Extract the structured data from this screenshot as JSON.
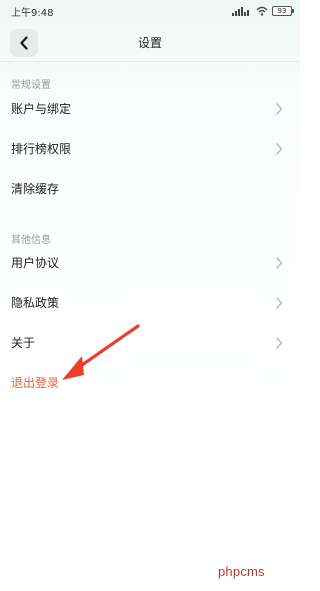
{
  "status_bar": {
    "time": "上午9:48",
    "battery": "93"
  },
  "nav": {
    "title": "设置"
  },
  "sections": {
    "general": {
      "header": "常规设置",
      "items": [
        {
          "label": "账户与绑定"
        },
        {
          "label": "排行榜权限"
        },
        {
          "label": "清除缓存"
        }
      ]
    },
    "other": {
      "header": "其他信息",
      "items": [
        {
          "label": "用户协议"
        },
        {
          "label": "隐私政策"
        },
        {
          "label": "关于"
        }
      ]
    }
  },
  "logout": {
    "label": "退出登录"
  },
  "annotation": {
    "arrow_color": "#e8402a"
  },
  "watermark": {
    "text": "phpcms"
  },
  "colors": {
    "logout": "#e0663a",
    "chevron": "#b8b8b8",
    "section_header": "#999999"
  }
}
